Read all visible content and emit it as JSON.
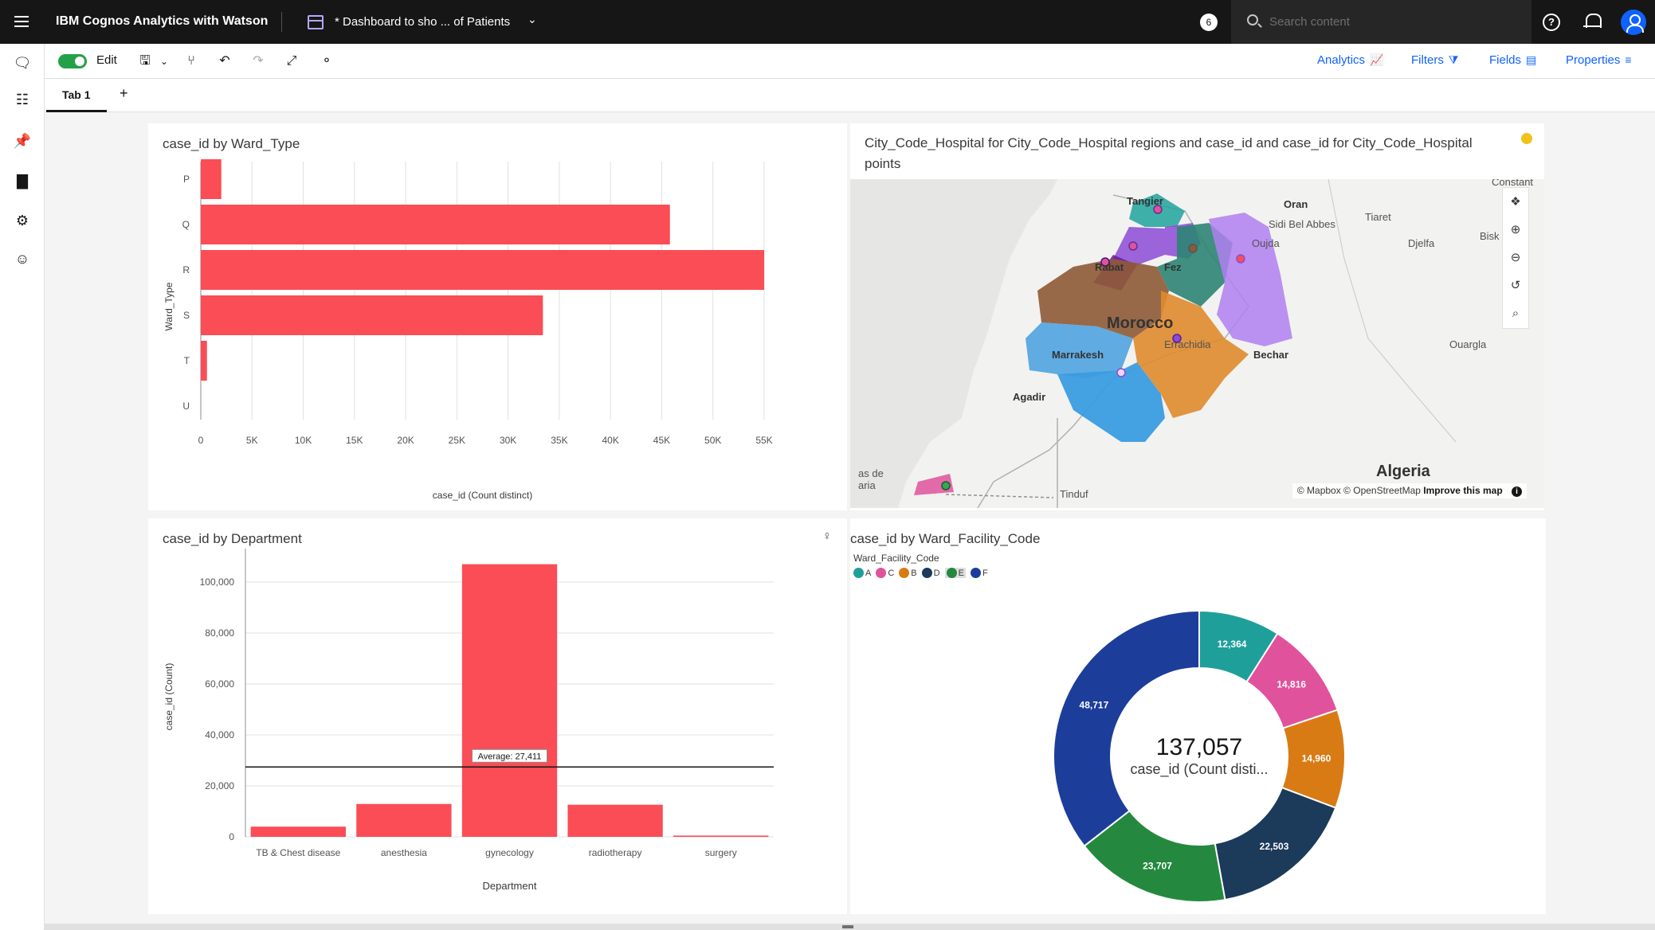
{
  "topbar": {
    "app_title": "IBM Cognos Analytics with Watson",
    "dashboard_title": "* Dashboard to sho ... of Patients",
    "notification_count": "6",
    "search_placeholder": "Search content"
  },
  "toolbar": {
    "edit_label": "Edit",
    "right_items": [
      "Analytics",
      "Filters",
      "Fields",
      "Properties"
    ]
  },
  "tabs": {
    "items": [
      "Tab 1"
    ],
    "add": "+"
  },
  "widgets": {
    "ward_type": {
      "title": "case_id by Ward_Type"
    },
    "map": {
      "title": "City_Code_Hospital for City_Code_Hospital regions and case_id and case_id for City_Code_Hospital points",
      "attribution": "© Mapbox © OpenStreetMap",
      "improve": "Improve this map",
      "labels": {
        "tangier": "Tangier",
        "oran": "Oran",
        "sidi_bel_abbes": "Sidi Bel Abbes",
        "tiaret": "Tiaret",
        "oujda": "Oujda",
        "djelfa": "Djelfa",
        "rabat": "Rabat",
        "fez": "Fez",
        "morocco": "Morocco",
        "errachidia": "Errachidia",
        "marrakesh": "Marrakesh",
        "bechar": "Bechar",
        "ouargla": "Ouargla",
        "agadir": "Agadir",
        "algeria": "Algeria",
        "tindouf": "Tinduf",
        "las_palmas": "as de\naria",
        "constantine": "Constant",
        "biskra": "Bisk"
      }
    },
    "department": {
      "title": "case_id by Department",
      "average_label": "Average: 27,411"
    },
    "facility": {
      "title": "case_id by Ward_Facility_Code",
      "legend_title": "Ward_Facility_Code",
      "total": "137,057",
      "total_label": "case_id (Count disti..."
    }
  },
  "chart_data": [
    {
      "type": "bar",
      "orientation": "horizontal",
      "title": "case_id by Ward_Type",
      "categories": [
        "P",
        "Q",
        "R",
        "S",
        "T",
        "U"
      ],
      "values": [
        2000,
        45800,
        55000,
        33400,
        600,
        0
      ],
      "xlabel": "case_id (Count distinct)",
      "ylabel": "Ward_Type",
      "xticks": [
        "0",
        "5K",
        "10K",
        "15K",
        "20K",
        "25K",
        "30K",
        "35K",
        "40K",
        "45K",
        "50K",
        "55K"
      ],
      "xlim": [
        0,
        55000
      ],
      "color": "#fa4d56"
    },
    {
      "type": "bar",
      "title": "case_id by Department",
      "categories": [
        "TB & Chest disease",
        "anesthesia",
        "gynecology",
        "radiotherapy",
        "surgery"
      ],
      "values": [
        4000,
        12900,
        107000,
        12600,
        500
      ],
      "average": 27411,
      "xlabel": "Department",
      "ylabel": "case_id (Count)",
      "yticks": [
        "0",
        "20,000",
        "40,000",
        "60,000",
        "80,000",
        "100,000"
      ],
      "ylim": [
        0,
        110000
      ],
      "color": "#fa4d56"
    },
    {
      "type": "pie",
      "title": "case_id by Ward_Facility_Code",
      "legend": [
        "A",
        "C",
        "B",
        "D",
        "E",
        "F"
      ],
      "slices": [
        {
          "name": "A",
          "value": 12364,
          "label": "12,364",
          "color": "#1f9f9a"
        },
        {
          "name": "C",
          "value": 14816,
          "label": "14,816",
          "color": "#e0529c"
        },
        {
          "name": "B",
          "value": 14960,
          "label": "14,960",
          "color": "#d97b14"
        },
        {
          "name": "D",
          "value": 22503,
          "label": "22,503",
          "color": "#1c3a5a"
        },
        {
          "name": "E",
          "value": 23707,
          "label": "23,707",
          "color": "#24893e"
        },
        {
          "name": "F",
          "value": 48717,
          "label": "48,717",
          "color": "#1d3d9a"
        }
      ]
    }
  ]
}
